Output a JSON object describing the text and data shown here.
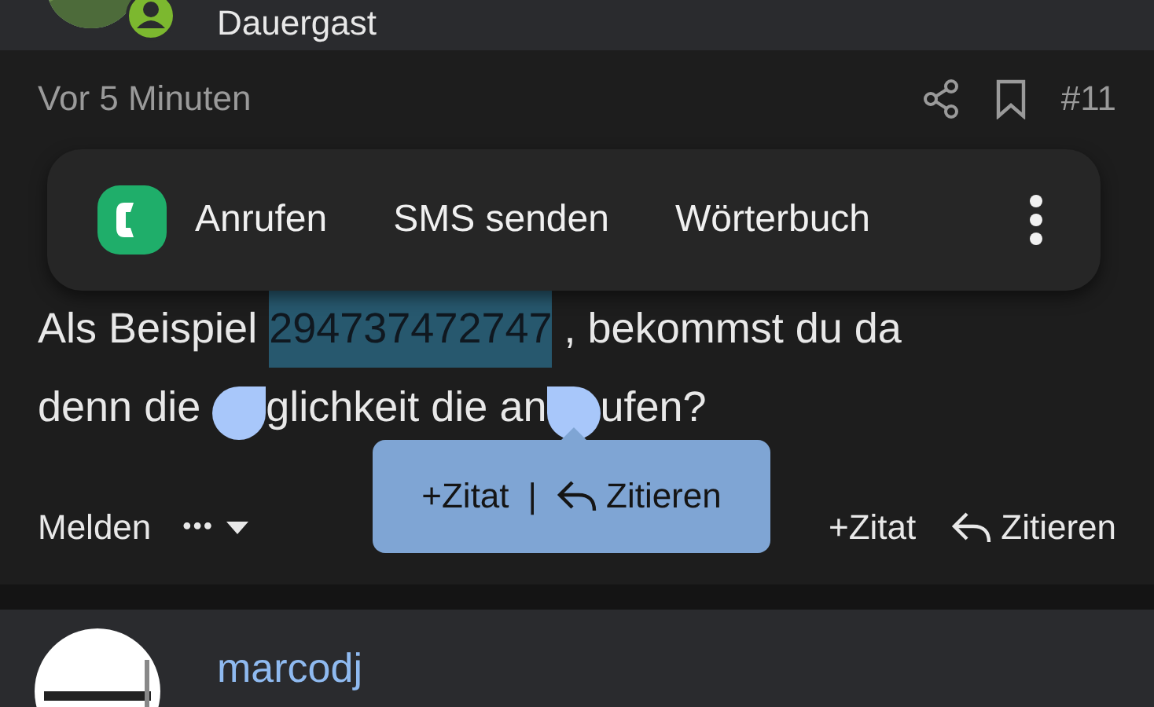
{
  "previous_post": {
    "author_status": "Dauergast"
  },
  "post": {
    "time": "Vor 5 Minuten",
    "number": "#11",
    "lines": [
      [
        {
          "kind": "text",
          "text": "Als Beispiel ",
          "selected": false
        },
        {
          "kind": "text",
          "text": "294737472747",
          "selected": true
        },
        {
          "kind": "text",
          "text": " , bekommst du da",
          "selected": false
        }
      ],
      [
        {
          "kind": "text",
          "text": "denn die ",
          "selected": false
        },
        {
          "kind": "handle"
        },
        {
          "kind": "text",
          "text": "glichkeit die an",
          "selected": false
        },
        {
          "kind": "handle"
        },
        {
          "kind": "text",
          "text": "ufen?",
          "selected": false
        }
      ]
    ],
    "actions": {
      "report": "Melden",
      "more": "•••",
      "add_quote": "+Zitat",
      "quote": "Zitieren"
    }
  },
  "text_menu": {
    "items": [
      {
        "kind": "app",
        "label": "Anrufen"
      },
      {
        "kind": "plain",
        "label": "SMS senden"
      },
      {
        "kind": "plain",
        "label": "Wörterbuch"
      }
    ]
  },
  "quote_popup": {
    "add_quote": "+Zitat",
    "separator": "|",
    "quote": "Zitieren"
  },
  "next_post": {
    "author": "marcodj"
  }
}
